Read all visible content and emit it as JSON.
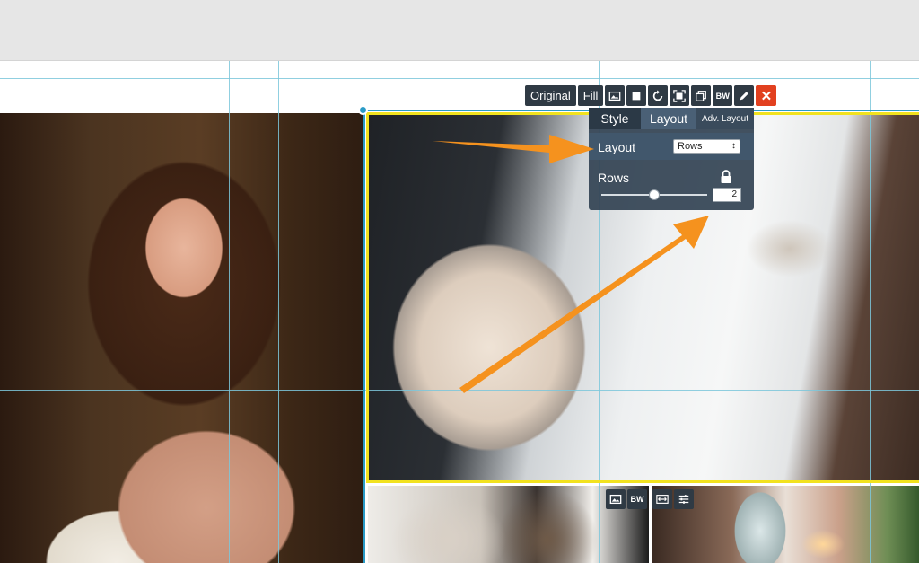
{
  "toolbar": {
    "original_label": "Original",
    "fill_label": "Fill",
    "bw_label": "BW",
    "close_glyph": "✕",
    "icons": [
      "replace-photo-icon",
      "crop-square-icon",
      "rotate-icon",
      "fit-frame-icon",
      "duplicate-icon",
      "edit-pencil-icon"
    ]
  },
  "panel": {
    "tabs": [
      "Style",
      "Layout",
      "Adv. Layout"
    ],
    "layout_label": "Layout",
    "layout_value": "Rows",
    "rows_label": "Rows",
    "rows_value": "2",
    "slider_fraction": 0.5
  },
  "tile_tools": {
    "bw_label": "BW"
  },
  "colors": {
    "selection_yellow": "#f2e21f",
    "selection_blue": "#2a9bc7",
    "guide": "#7cc7da",
    "annotation_arrow": "#f5921e",
    "close_red": "#e2401f",
    "toolbar_bg": "#2f3a44"
  }
}
